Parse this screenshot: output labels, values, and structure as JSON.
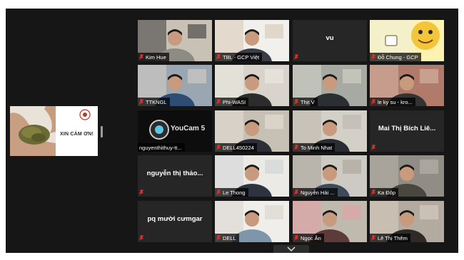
{
  "shared_screen": {
    "caption": "XIN CẢM ƠN!"
  },
  "participants": [
    {
      "name": "Kim Hue",
      "video": true
    },
    {
      "name": "TBL - GCP Việt",
      "video": true
    },
    {
      "name": "",
      "big_label": "vu",
      "video": false
    },
    {
      "name": "Đỗ Chung - GCP",
      "video": true,
      "active_speaker": true
    },
    {
      "name": "TTKNGL",
      "video": true
    },
    {
      "name": "Phi-WASI",
      "video": true
    },
    {
      "name": "Thịt V",
      "video": true
    },
    {
      "name": "le ky su - kro...",
      "video": true
    },
    {
      "name": "nguyenthithuy-tt...",
      "video": true,
      "overlay_text": "YouCam 5",
      "muted_icon": false
    },
    {
      "name": "DELL450224",
      "video": true
    },
    {
      "name": "To Minh Nhat",
      "video": true
    },
    {
      "name": "",
      "big_label": "Mai Thị Bích Liê...",
      "video": false
    },
    {
      "name": "",
      "big_label": "nguyễn thị thảo...",
      "video": false
    },
    {
      "name": "Le Thong",
      "video": true
    },
    {
      "name": "Nguyễn Hải ...",
      "video": true
    },
    {
      "name": "Ka Đôp",
      "video": true
    },
    {
      "name": "",
      "big_label": "pq mười cưmgar",
      "video": false
    },
    {
      "name": "DELL",
      "video": true
    },
    {
      "name": "Ngọc Ân",
      "video": true
    },
    {
      "name": "Lê Thị Thêm",
      "video": true
    }
  ],
  "colors": {
    "background": "#161616",
    "muted_icon": "#e0312b",
    "active_speaker_border": "#e9ee3a"
  },
  "icons": {
    "muted": "mic-muted-icon",
    "scroll": "chevron-down-icon"
  }
}
